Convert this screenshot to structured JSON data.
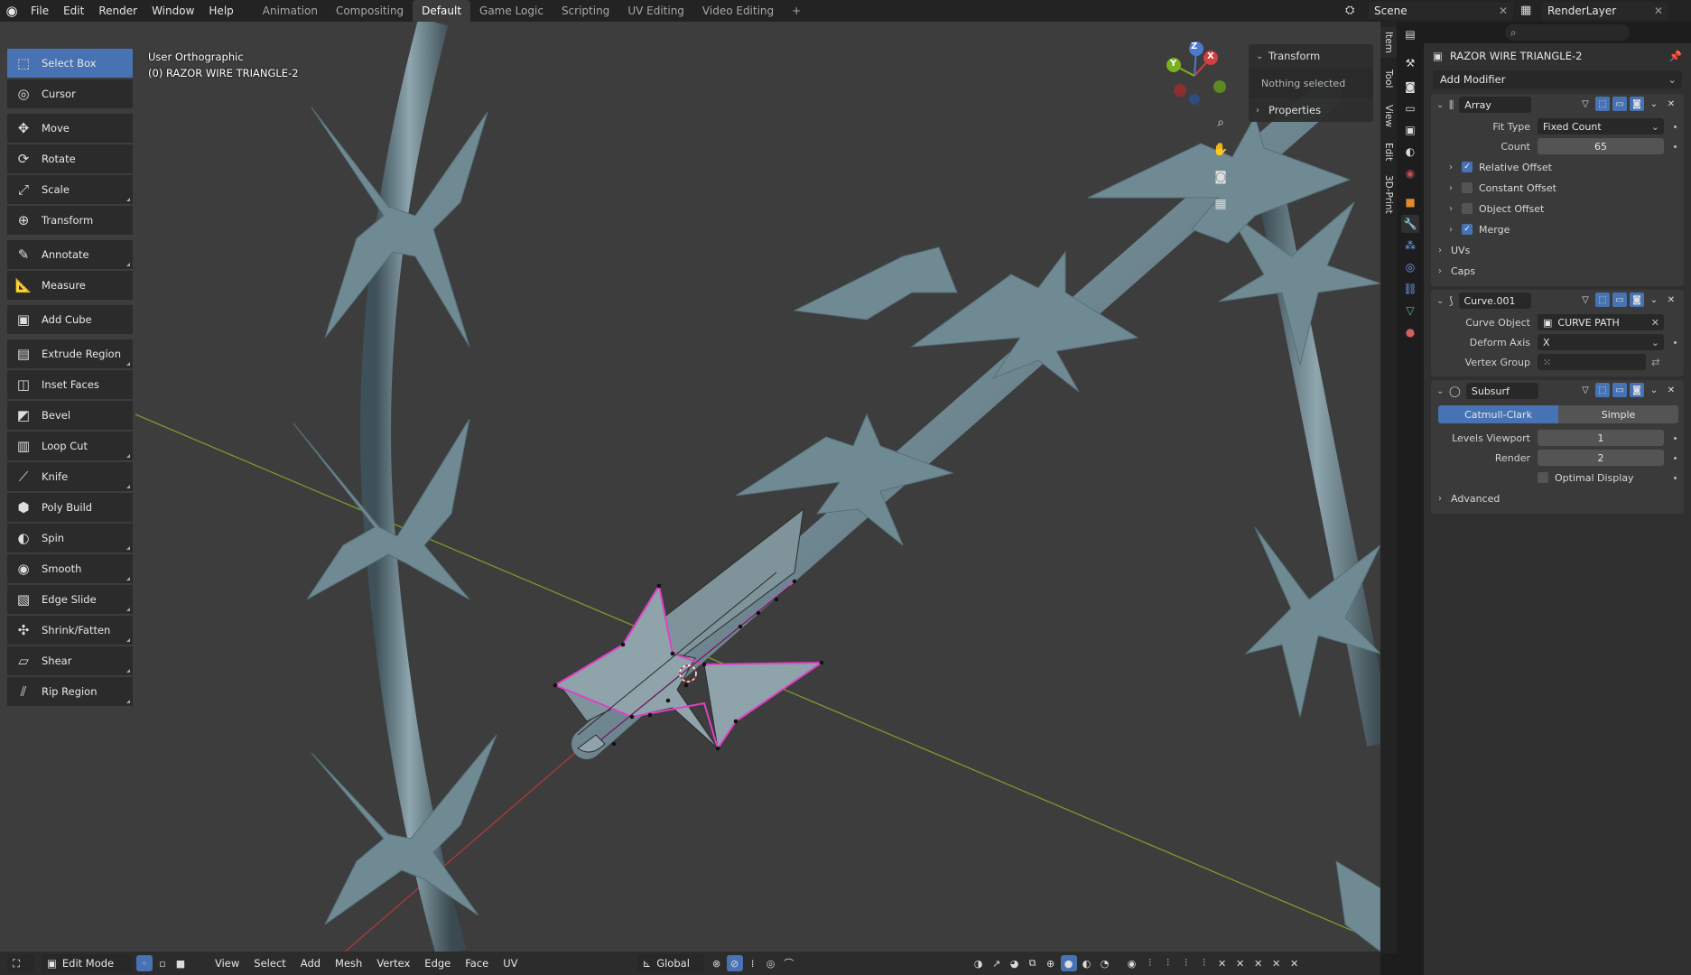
{
  "topbar": {
    "menus": [
      "File",
      "Edit",
      "Render",
      "Window",
      "Help"
    ],
    "workspaces": [
      "Animation",
      "Compositing",
      "Default",
      "Game Logic",
      "Scripting",
      "UV Editing",
      "Video Editing"
    ],
    "active_workspace": "Default",
    "add_workspace": "+",
    "scene": "Scene",
    "render_layer": "RenderLayer"
  },
  "toolbar": {
    "tools": [
      {
        "label": "Select Box",
        "icon": "select-box-icon",
        "glyph": "⬚",
        "active": true
      },
      {
        "label": "Cursor",
        "icon": "cursor-icon",
        "glyph": "◎"
      },
      {
        "label": "Move",
        "icon": "move-icon",
        "glyph": "✥"
      },
      {
        "label": "Rotate",
        "icon": "rotate-icon",
        "glyph": "⟳"
      },
      {
        "label": "Scale",
        "icon": "scale-icon",
        "glyph": "⤢"
      },
      {
        "label": "Transform",
        "icon": "transform-icon",
        "glyph": "⊕"
      },
      {
        "label": "Annotate",
        "icon": "annotate-icon",
        "glyph": "✎"
      },
      {
        "label": "Measure",
        "icon": "measure-icon",
        "glyph": "📐"
      },
      {
        "label": "Add Cube",
        "icon": "add-cube-icon",
        "glyph": "▣"
      },
      {
        "label": "Extrude Region",
        "icon": "extrude-icon",
        "glyph": "▤"
      },
      {
        "label": "Inset Faces",
        "icon": "inset-icon",
        "glyph": "◫"
      },
      {
        "label": "Bevel",
        "icon": "bevel-icon",
        "glyph": "◩"
      },
      {
        "label": "Loop Cut",
        "icon": "loop-cut-icon",
        "glyph": "▥"
      },
      {
        "label": "Knife",
        "icon": "knife-icon",
        "glyph": "⟋"
      },
      {
        "label": "Poly Build",
        "icon": "poly-build-icon",
        "glyph": "⬢"
      },
      {
        "label": "Spin",
        "icon": "spin-icon",
        "glyph": "◐"
      },
      {
        "label": "Smooth",
        "icon": "smooth-icon",
        "glyph": "◉"
      },
      {
        "label": "Edge Slide",
        "icon": "edge-slide-icon",
        "glyph": "▧"
      },
      {
        "label": "Shrink/Fatten",
        "icon": "shrink-fatten-icon",
        "glyph": "✣"
      },
      {
        "label": "Shear",
        "icon": "shear-icon",
        "glyph": "▱"
      },
      {
        "label": "Rip Region",
        "icon": "rip-region-icon",
        "glyph": "⫽"
      }
    ]
  },
  "viewport": {
    "view_name": "User Orthographic",
    "object_label": "(0) RAZOR WIRE TRIANGLE-2"
  },
  "npanel": {
    "transform_label": "Transform",
    "nothing_selected": "Nothing selected",
    "properties_label": "Properties",
    "tabs": [
      "Item",
      "Tool",
      "View",
      "Edit",
      "3D-Print"
    ]
  },
  "gizmo": {
    "x": "X",
    "y": "Y",
    "z": "Z"
  },
  "header": {
    "mode": "Edit Mode",
    "menus": [
      "View",
      "Select",
      "Add",
      "Mesh",
      "Vertex",
      "Edge",
      "Face",
      "UV"
    ],
    "orientation": "Global"
  },
  "properties": {
    "object_name": "RAZOR WIRE TRIANGLE-2",
    "add_modifier": "Add Modifier",
    "array": {
      "name": "Array",
      "fit_type_label": "Fit Type",
      "fit_type": "Fixed Count",
      "count_label": "Count",
      "count": "65",
      "subpanels": [
        {
          "label": "Relative Offset",
          "checkbox": true,
          "checked": true
        },
        {
          "label": "Constant Offset",
          "checkbox": true,
          "checked": false
        },
        {
          "label": "Object Offset",
          "checkbox": true,
          "checked": false
        },
        {
          "label": "Merge",
          "checkbox": true,
          "checked": true
        },
        {
          "label": "UVs",
          "checkbox": false
        },
        {
          "label": "Caps",
          "checkbox": false
        }
      ]
    },
    "curve": {
      "name": "Curve.001",
      "curve_object_label": "Curve Object",
      "curve_object": "CURVE PATH",
      "deform_axis_label": "Deform Axis",
      "deform_axis": "X",
      "vertex_group_label": "Vertex Group"
    },
    "subsurf": {
      "name": "Subsurf",
      "mode_a": "Catmull-Clark",
      "mode_b": "Simple",
      "levels_viewport_label": "Levels Viewport",
      "levels_viewport": "1",
      "render_label": "Render",
      "render": "2",
      "optimal_display": "Optimal Display",
      "advanced": "Advanced"
    }
  },
  "colors": {
    "accent": "#4772b3",
    "selected_edge": "#e040c8",
    "viewport_bg": "#3d3d3d",
    "wire_mesh": "#6f8a93"
  }
}
